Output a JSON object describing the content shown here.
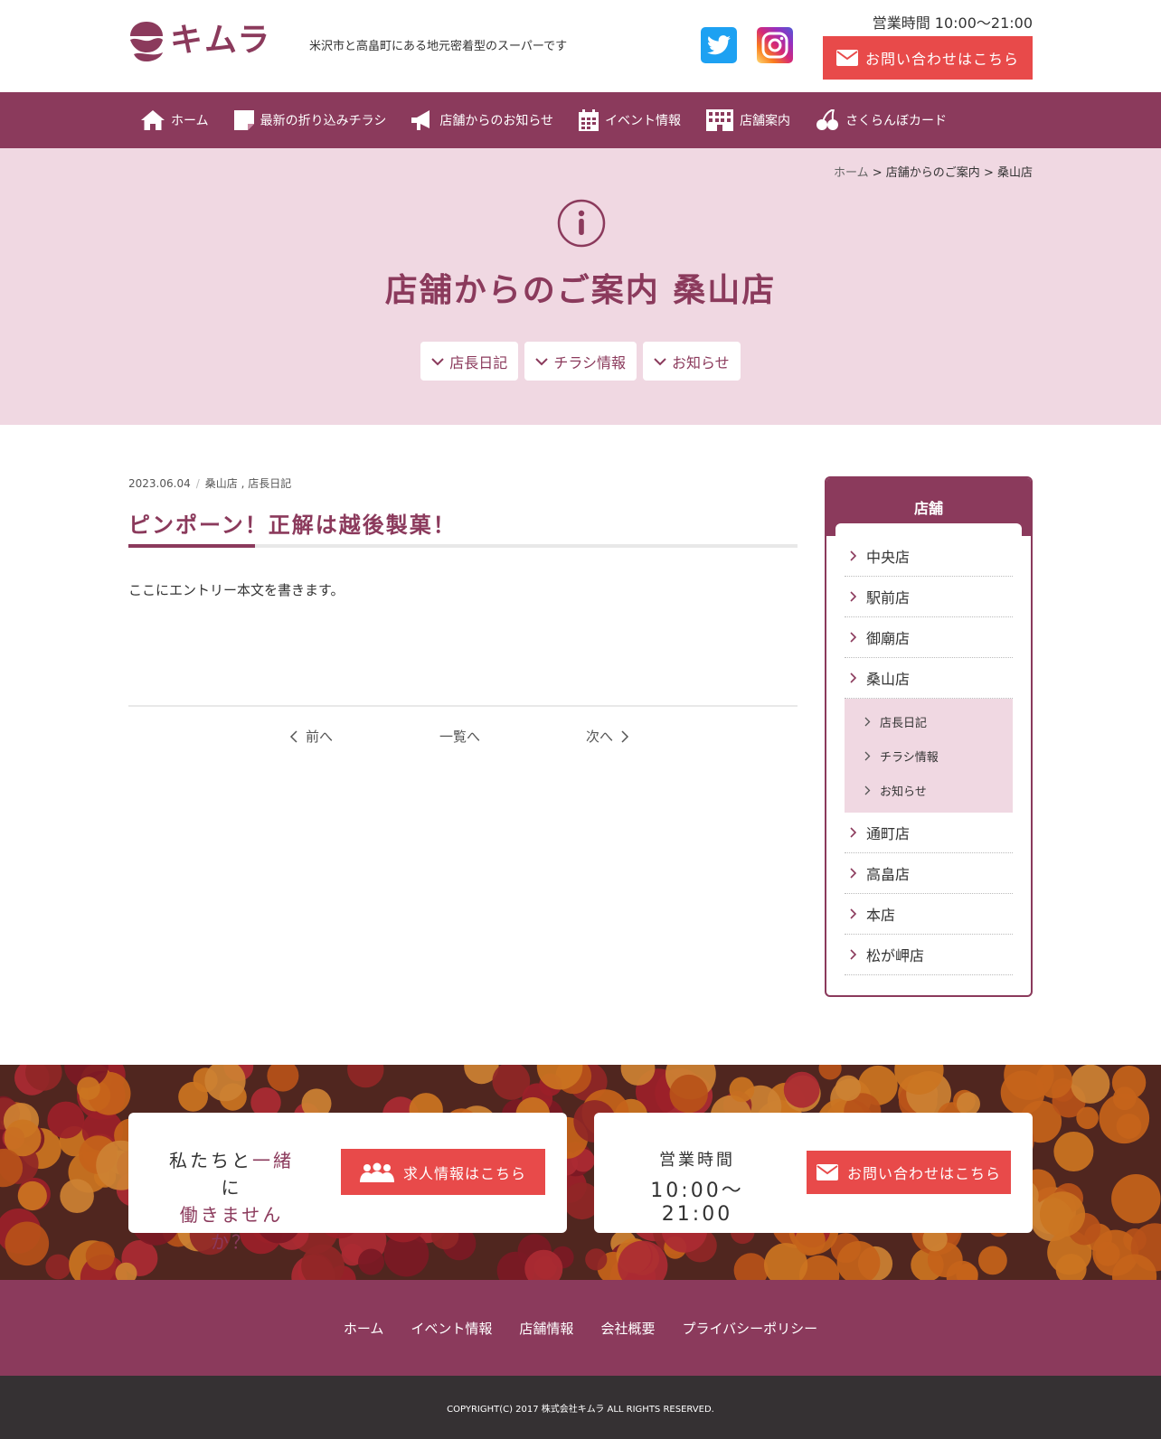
{
  "header": {
    "logo_text": "キムラ",
    "tagline": "米沢市と高畠町にある地元密着型のスーパーです",
    "hours": "営業時間 10:00〜21:00",
    "contact_label": "お問い合わせはこちら"
  },
  "nav": {
    "items": [
      {
        "label": "ホーム",
        "icon": "home-icon"
      },
      {
        "label": "最新の折り込みチラシ",
        "icon": "flyer-icon"
      },
      {
        "label": "店舗からのお知らせ",
        "icon": "megaphone-icon"
      },
      {
        "label": "イベント情報",
        "icon": "calendar-icon"
      },
      {
        "label": "店舗案内",
        "icon": "building-icon"
      },
      {
        "label": "さくらんぼカード",
        "icon": "cherry-icon"
      }
    ]
  },
  "breadcrumb": {
    "home": "ホーム",
    "sep": " > ",
    "section": "店舗からのご案内",
    "current": "桑山店"
  },
  "hero": {
    "title": "店舗からのご案内 桑山店",
    "tabs": [
      "店長日記",
      "チラシ情報",
      "お知らせ"
    ]
  },
  "article": {
    "date": "2023.06.04",
    "categories": "桑山店 , 店長日記",
    "title": "ピンポーン！正解は越後製菓！",
    "body": "ここにエントリー本文を書きます。",
    "prev": "前へ",
    "list": "一覧へ",
    "next": "次へ"
  },
  "sidebar": {
    "title": "店舗",
    "items_before": [
      "中央店",
      "駅前店",
      "御廟店",
      "桑山店"
    ],
    "sub_items": [
      "店長日記",
      "チラシ情報",
      "お知らせ"
    ],
    "items_after": [
      "通町店",
      "高畠店",
      "本店",
      "松が岬店"
    ]
  },
  "banner": {
    "recruit_line1": "私たちと",
    "recruit_accent": "一緒",
    "recruit_line1_end": "に",
    "recruit_line2": "働きませんか？",
    "recruit_button": "求人情報はこちら",
    "hours_label": "営業時間",
    "hours_value": "10:00〜21:00",
    "contact_button": "お問い合わせはこちら"
  },
  "footer": {
    "links": [
      "ホーム",
      "イベント情報",
      "店舗情報",
      "会社概要",
      "プライバシーポリシー"
    ],
    "copyright": "COPYRIGHT(C) 2017 株式会社キムラ ALL RIGHTS RESERVED."
  },
  "colors": {
    "brand": "#8b3a5c",
    "accent_red": "#e84a4a",
    "hero_bg": "#f0d8e2",
    "footer_dark": "#353133"
  }
}
